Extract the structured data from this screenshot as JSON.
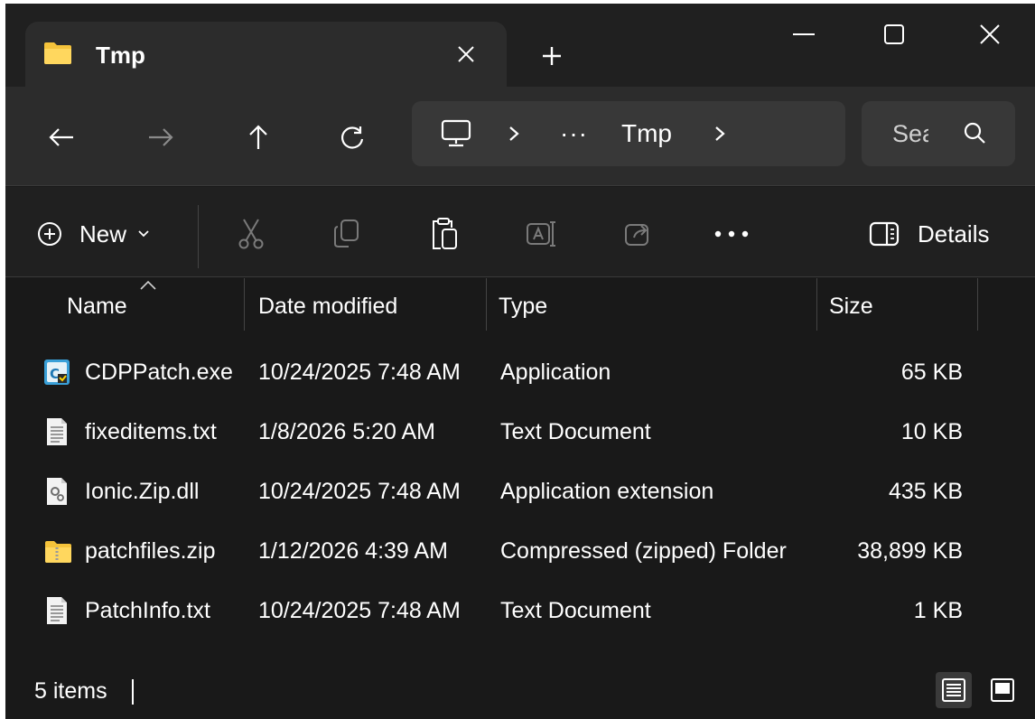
{
  "window": {
    "tab_title": "Tmp"
  },
  "nav": {
    "breadcrumb": [
      "Tmp"
    ],
    "overflow_label": "···",
    "search_placeholder": "Sea"
  },
  "command_bar": {
    "new_label": "New",
    "details_label": "Details"
  },
  "columns": {
    "name": "Name",
    "date_modified": "Date modified",
    "type": "Type",
    "size": "Size"
  },
  "files": [
    {
      "name": "CDPPatch.exe",
      "date": "10/24/2025 7:48 AM",
      "type": "Application",
      "size": "65 KB",
      "icon": "exe-icon"
    },
    {
      "name": "fixeditems.txt",
      "date": "1/8/2026 5:20 AM",
      "type": "Text Document",
      "size": "10 KB",
      "icon": "text-file-icon"
    },
    {
      "name": "Ionic.Zip.dll",
      "date": "10/24/2025 7:48 AM",
      "type": "Application extension",
      "size": "435 KB",
      "icon": "dll-file-icon"
    },
    {
      "name": "patchfiles.zip",
      "date": "1/12/2026 4:39 AM",
      "type": "Compressed (zipped) Folder",
      "size": "38,899 KB",
      "icon": "zip-folder-icon"
    },
    {
      "name": "PatchInfo.txt",
      "date": "10/24/2025 7:48 AM",
      "type": "Text Document",
      "size": "1 KB",
      "icon": "text-file-icon"
    }
  ],
  "status": {
    "item_count": "5 items"
  },
  "colors": {
    "background": "#191919",
    "chrome": "#202020",
    "tab_active": "#2c2c2c",
    "folder_yellow": "#f5c33b"
  }
}
